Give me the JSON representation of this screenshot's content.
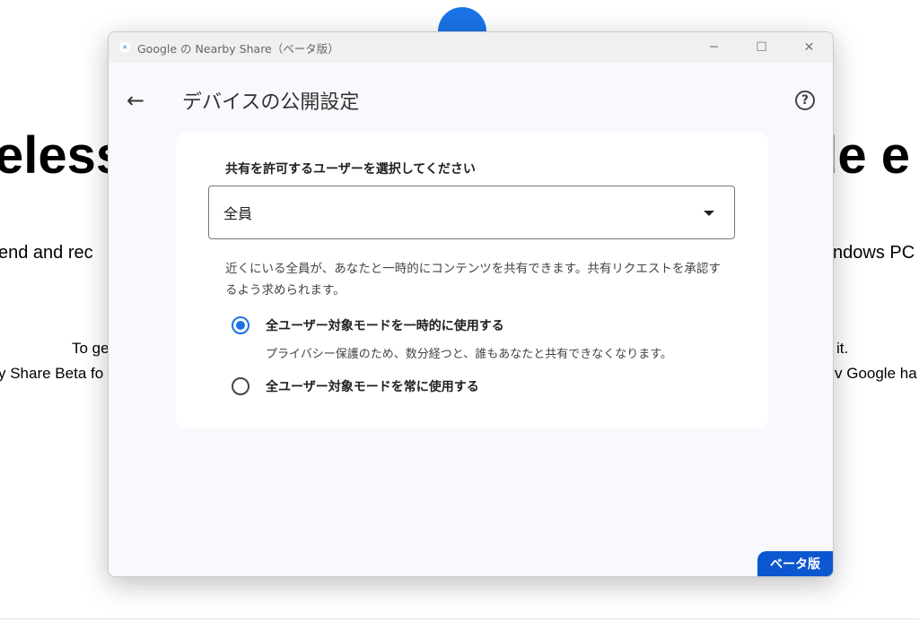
{
  "background": {
    "headline_left": "eless",
    "headline_right": "de e",
    "line1_left": "end and rec",
    "line1_right": "ndows PC",
    "line2_left": "To ge",
    "line2_right": "it.",
    "line3_left": "y Share Beta fo",
    "line3_right": "v Google ha"
  },
  "window": {
    "title": "Google の Nearby Share（ベータ版）",
    "minimize": "─",
    "maximize": "☐",
    "close": "✕"
  },
  "header": {
    "back": "←",
    "title": "デバイスの公開設定",
    "help": "?"
  },
  "card": {
    "label": "共有を許可するユーザーを選択してください",
    "select_value": "全員",
    "description": "近くにいる全員が、あなたと一時的にコンテンツを共有できます。共有リクエストを承認するよう求められます。",
    "options": [
      {
        "label": "全ユーザー対象モードを一時的に使用する",
        "selected": true,
        "sub": "プライバシー保護のため、数分経つと、誰もあなたと共有できなくなります。"
      },
      {
        "label": "全ユーザー対象モードを常に使用する",
        "selected": false
      }
    ]
  },
  "beta_badge": "ベータ版",
  "colors": {
    "accent": "#1a73e8",
    "badge": "#0b57d0"
  }
}
